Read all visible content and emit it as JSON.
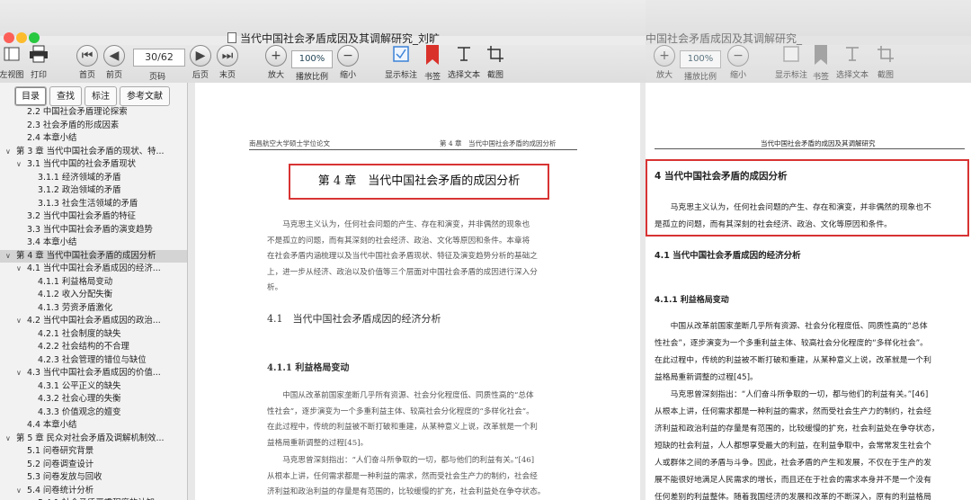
{
  "left_window": {
    "title": "当代中国社会矛盾成因及其调解研究_刘旷",
    "toolbar": {
      "sidebar_label": "左视图",
      "print_label": "打印",
      "first_label": "首页",
      "prev_label": "前页",
      "page_value": "30/62",
      "page_label": "页码",
      "next_label": "后页",
      "last_label": "末页",
      "zoom_in_label": "放大",
      "zoom_value": "100%",
      "zoom_ratio_label": "播放比例",
      "zoom_out_label": "缩小",
      "show_annotations_label": "显示标注",
      "bookmark_label": "书签",
      "select_text_label": "选择文本",
      "screenshot_label": "截图"
    },
    "sidebar": {
      "tabs": [
        "目录",
        "查找",
        "标注",
        "参考文献"
      ],
      "items": [
        {
          "label": "2.2 中国社会矛盾理论探索",
          "indent": 2,
          "chev": ""
        },
        {
          "label": "2.3 社会矛盾的形成因素",
          "indent": 2,
          "chev": ""
        },
        {
          "label": "2.4 本章小结",
          "indent": 2,
          "chev": ""
        },
        {
          "label": "第 3 章 当代中国社会矛盾的现状、特...",
          "indent": 1,
          "chev": "∨"
        },
        {
          "label": "3.1 当代中国的社会矛盾现状",
          "indent": 2,
          "chev": "∨"
        },
        {
          "label": "3.1.1 经济领域的矛盾",
          "indent": 3,
          "chev": ""
        },
        {
          "label": "3.1.2 政治领域的矛盾",
          "indent": 3,
          "chev": ""
        },
        {
          "label": "3.1.3 社会生活领域的矛盾",
          "indent": 3,
          "chev": ""
        },
        {
          "label": "3.2 当代中国社会矛盾的特征",
          "indent": 2,
          "chev": ""
        },
        {
          "label": "3.3 当代中国社会矛盾的演变趋势",
          "indent": 2,
          "chev": ""
        },
        {
          "label": "3.4 本章小结",
          "indent": 2,
          "chev": ""
        },
        {
          "label": "第 4 章 当代中国社会矛盾的成因分析",
          "indent": 1,
          "chev": "∨",
          "selected": true
        },
        {
          "label": "4.1 当代中国社会矛盾成因的经济...",
          "indent": 2,
          "chev": "∨"
        },
        {
          "label": "4.1.1 利益格局变动",
          "indent": 3,
          "chev": ""
        },
        {
          "label": "4.1.2 收入分配失衡",
          "indent": 3,
          "chev": ""
        },
        {
          "label": "4.1.3 劳资矛盾激化",
          "indent": 3,
          "chev": ""
        },
        {
          "label": "4.2 当代中国社会矛盾成因的政治...",
          "indent": 2,
          "chev": "∨"
        },
        {
          "label": "4.2.1 社会制度的缺失",
          "indent": 3,
          "chev": ""
        },
        {
          "label": "4.2.2 社会结构的不合理",
          "indent": 3,
          "chev": ""
        },
        {
          "label": "4.2.3 社会管理的错位与缺位",
          "indent": 3,
          "chev": ""
        },
        {
          "label": "4.3 当代中国社会矛盾成因的价值...",
          "indent": 2,
          "chev": "∨"
        },
        {
          "label": "4.3.1 公平正义的缺失",
          "indent": 3,
          "chev": ""
        },
        {
          "label": "4.3.2 社会心理的失衡",
          "indent": 3,
          "chev": ""
        },
        {
          "label": "4.3.3 价值观念的嬗变",
          "indent": 3,
          "chev": ""
        },
        {
          "label": "4.4 本章小结",
          "indent": 2,
          "chev": ""
        },
        {
          "label": "第 5 章 民众对社会矛盾及调解机制效...",
          "indent": 1,
          "chev": "∨"
        },
        {
          "label": "5.1 问卷研究背景",
          "indent": 2,
          "chev": ""
        },
        {
          "label": "5.2 问卷调查设计",
          "indent": 2,
          "chev": ""
        },
        {
          "label": "5.3 问卷发放与回收",
          "indent": 2,
          "chev": ""
        },
        {
          "label": "5.4 问卷统计分析",
          "indent": 2,
          "chev": "∨"
        },
        {
          "label": "5.4.1 社会矛盾严重程度的认知",
          "indent": 3,
          "chev": ""
        }
      ]
    },
    "page": {
      "header_left": "南昌航空大学硕士学位论文",
      "header_right": "第 4 章　当代中国社会矛盾的成因分析",
      "chapter_title": "第 4 章　当代中国社会矛盾的成因分析",
      "intro": [
        "　　马克思主义认为，任何社会问题的产生、存在和演变，并非偶然的现象也",
        "不是孤立的问题，而有其深刻的社会经济、政治、文化等原因和条件。本章将",
        "在社会矛盾内涵梳理以及当代中国社会矛盾现状、特征及演变趋势分析的基础之",
        "上，进一步从经济、政治以及价值等三个层面对中国社会矛盾的成因进行深入分",
        "析。"
      ],
      "section": "4.1　当代中国社会矛盾成因的经济分析",
      "subsection": "4.1.1 利益格局变动",
      "body1": [
        "　　中国从改革前国家垄断几乎所有资源、社会分化程度低、同质性高的“总体",
        "性社会”，逐步演变为一个多重利益主体、较高社会分化程度的“多样化社会”。",
        "在此过程中，传统的利益被不断打破和重建，从某种意义上说，改革就是一个利",
        "益格局重新调整的过程[45]。"
      ],
      "body2": [
        "　　马克思曾深刻指出：“人们奋斗所争取的一切，都与他们的利益有关。”[46]",
        "从根本上讲，任何需求都是一种利益的需求，然而受社会生产力的制约，社会经",
        "济利益和政治利益的存量是有范围的，比较缓慢的扩充，社会利益处在争夺状态。"
      ]
    }
  },
  "right_window": {
    "title": "中国社会矛盾成因及其调解研究_",
    "toolbar": {
      "zoom_in_label": "放大",
      "zoom_value": "100%",
      "zoom_ratio_label": "播放比例",
      "zoom_out_label": "缩小",
      "show_annotations_label": "显示标注",
      "bookmark_label": "书签",
      "select_text_label": "选择文本",
      "screenshot_label": "截图"
    },
    "page": {
      "header": "当代中国社会矛盾的成因及其调解研究",
      "chapter_title": "4  当代中国社会矛盾的成因分析",
      "intro": [
        "　　马克思主义认为，任何社会问题的产生、存在和演变，并非偶然的现象也不",
        "是孤立的问题，而有其深刻的社会经济、政治、文化等原因和条件。"
      ],
      "section": "4.1  当代中国社会矛盾成因的经济分析",
      "subsection": "4.1.1 利益格局变动",
      "body": [
        "　　中国从改革前国家垄断几乎所有资源、社会分化程度低、同质性高的“总体",
        "性社会”，逐步演变为一个多重利益主体、较高社会分化程度的“多样化社会”。",
        "在此过程中，传统的利益被不断打破和重建，从某种意义上说，改革就是一个利",
        "益格局重新调整的过程[45]。",
        "　　马克思曾深刻指出：“人们奋斗所争取的一切，都与他们的利益有关。”[46]",
        "从根本上讲，任何需求都是一种利益的需求，然而受社会生产力的制约，社会经",
        "济利益和政治利益的存量是有范围的，比较缓慢的扩充，社会利益处在争夺状态，",
        "短缺的社会利益，人人都想享受最大的利益，在利益争取中，会常常发生社会个",
        "人或群体之间的矛盾与斗争。因此，社会矛盾的产生和发展，不仅在于生产的发",
        "展不能很好地满足人民需求的增长，而且还在于社会的需求本身并不是一个没有",
        "任何差别的利益整体。随着我国经济的发展和改革的不断深入，原有的利益格局",
        "被打破，新的利益格局在逐步重构之中吗，这种利益的日益分化，带来了利益群"
      ]
    }
  },
  "colors": {
    "highlight": "#d83333",
    "close": "#fc5f57",
    "minimize": "#fdbc2e",
    "zoom": "#28c840",
    "bookmark_red": "#d9322b",
    "accent_blue": "#3b82d6"
  }
}
